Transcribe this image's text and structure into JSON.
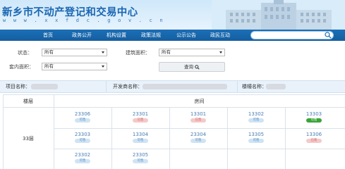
{
  "header": {
    "title": "新乡市不动产登记和交易中心",
    "url": "w w w . x x f d c . g o v . c n"
  },
  "nav": {
    "items": [
      "首页",
      "政务公开",
      "机构设置",
      "政策法规",
      "公示公告",
      "政民互动"
    ]
  },
  "filters": {
    "status_label": "状态：",
    "status_value": "所有",
    "area_label": "建筑面积：",
    "area_value": "所有",
    "inner_label": "套内面积：",
    "inner_value": "所有",
    "query_label": "查询"
  },
  "info": {
    "project_label": "项目名称：",
    "developer_label": "开发商名称：",
    "building_label": "楼幢名称："
  },
  "table": {
    "floor_header": "楼层",
    "room_header": "房间",
    "floor_label": "33层",
    "units": [
      {
        "num": "23306",
        "status": "可售"
      },
      {
        "num": "23301",
        "status": "已售"
      },
      {
        "num": "13301",
        "status": "已售"
      },
      {
        "num": "13302",
        "status": "可售"
      },
      {
        "num": "13303",
        "status": "可售"
      },
      {
        "num": "23303",
        "status": "可售"
      },
      {
        "num": "13304",
        "status": "可售"
      },
      {
        "num": "23304",
        "status": "可售"
      },
      {
        "num": "13305",
        "status": "可售"
      },
      {
        "num": "13306",
        "status": "已售"
      },
      {
        "num": "23302",
        "status": "可售"
      },
      {
        "num": "23305",
        "status": "可售"
      }
    ]
  },
  "colors": {
    "brand_blue": "#1b6fb8",
    "available": "#cfe3f4",
    "sold": "#f5c9c9",
    "highlight": "#3aa53a"
  }
}
